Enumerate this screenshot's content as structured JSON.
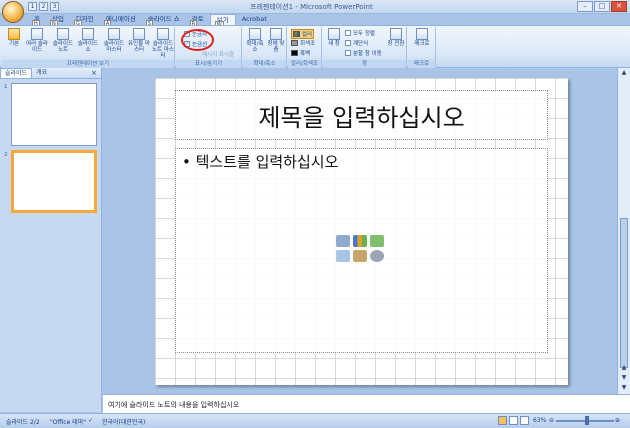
{
  "window": {
    "title": "프레젠테이션1 - Microsoft PowerPoint",
    "controls": [
      "–",
      "□",
      "✕"
    ]
  },
  "qat": {
    "keys": [
      "1",
      "2",
      "3"
    ]
  },
  "tabs": [
    {
      "label": "홈",
      "key": "H"
    },
    {
      "label": "삽입",
      "key": "N"
    },
    {
      "label": "디자인",
      "key": "G"
    },
    {
      "label": "애니메이션",
      "key": "A"
    },
    {
      "label": "슬라이드 쇼",
      "key": "S"
    },
    {
      "label": "검토",
      "key": "R"
    },
    {
      "label": "보기",
      "key": "W"
    },
    {
      "label": "Acrobat",
      "key": ""
    }
  ],
  "ribbon": {
    "views": {
      "label": "프레젠테이션 보기",
      "buttons": [
        "기본",
        "여러 슬라이드",
        "슬라이드 노트",
        "슬라이드 쇼",
        "슬라이드 마스터",
        "유인물 마스터",
        "슬라이드 노트 마스터"
      ]
    },
    "show": {
      "label": "표시/숨기기",
      "ruler": "눈금자",
      "gridlines": "눈금선",
      "message_bar": "메시지 표시줄"
    },
    "zoom": {
      "label": "확대/축소",
      "buttons": [
        "확대/축소",
        "창에 맞춤"
      ]
    },
    "color": {
      "label": "컬러/회색조",
      "options": [
        "컬러",
        "회색조",
        "흑백"
      ]
    },
    "window": {
      "label": "창",
      "buttons": [
        "새 창",
        "모두 정렬",
        "계단식",
        "분할 창 이동",
        "창 전환"
      ]
    },
    "macro": {
      "label": "매크로",
      "button": "매크로"
    }
  },
  "pane": {
    "tabs": [
      "슬라이드",
      "개요"
    ],
    "close": "×",
    "slides": [
      {
        "num": "1"
      },
      {
        "num": "2"
      }
    ]
  },
  "slide": {
    "title_placeholder": "제목을 입력하십시오",
    "body_placeholder": "• 텍스트를 입력하십시오"
  },
  "notes": {
    "placeholder": "여기에 슬라이드 노트의 내용을 입력하십시오"
  },
  "status": {
    "slide": "슬라이드 2/2",
    "theme": "\"Office 테마\"",
    "language": "한국어(대한민국)",
    "zoom": "63%"
  },
  "colors": {
    "ribbon": "#dbe7f6",
    "accent": "#f6a83a",
    "annotation": "#e21c1c"
  }
}
